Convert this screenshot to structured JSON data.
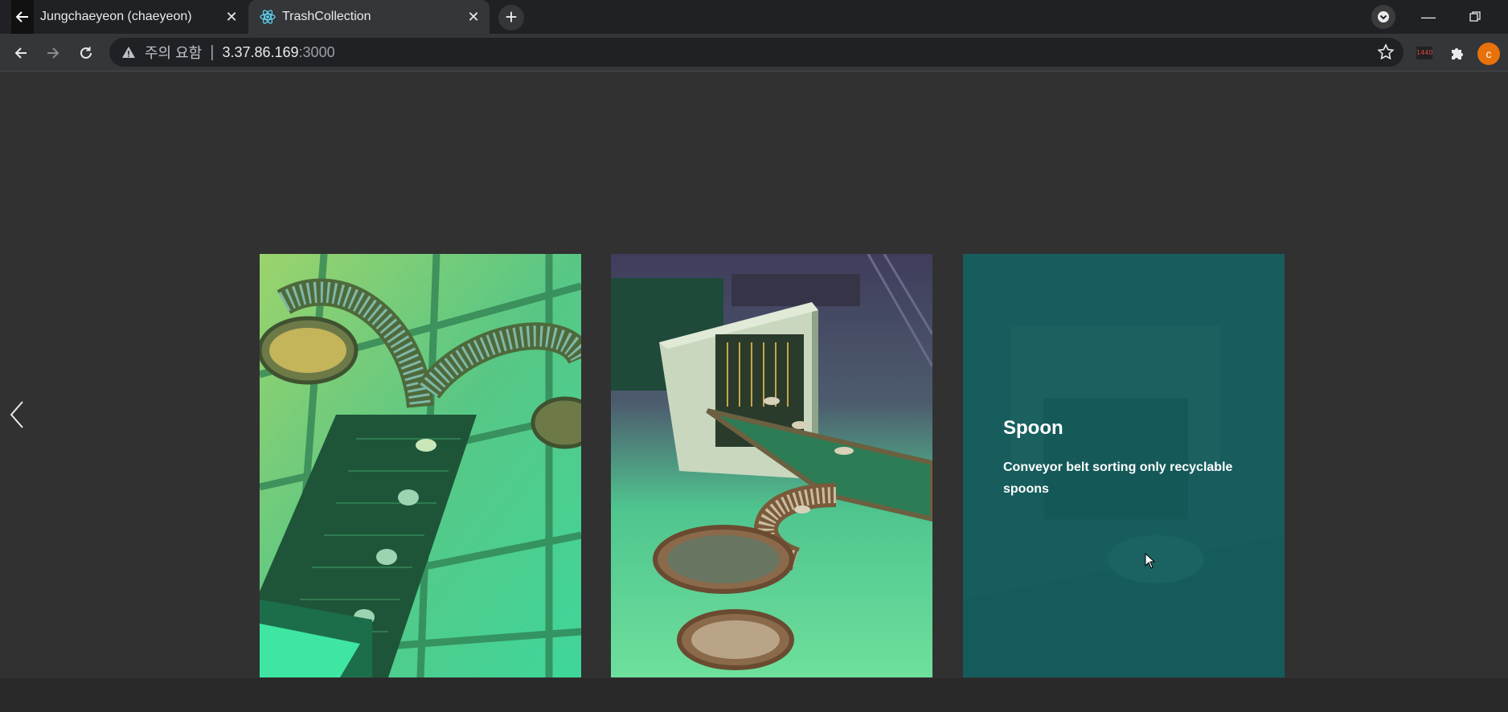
{
  "browser": {
    "tabs": [
      {
        "label": "Jungchaeyeon (chaeyeon)",
        "active": false
      },
      {
        "label": "TrashCollection",
        "active": true
      }
    ],
    "omnibox": {
      "security_label": "주의 요함",
      "separator": "|",
      "host": "3.37.86.169",
      "port": ":3000"
    },
    "extension_badge": "1440",
    "avatar_letter": "c",
    "accent_color": "#e8710a"
  },
  "carousel": {
    "cards": [
      {
        "type": "image",
        "alt_icon": "conveyor-scene-image"
      },
      {
        "type": "image",
        "alt_icon": "scanner-scene-image"
      },
      {
        "type": "text",
        "title": "Spoon",
        "description": "Conveyor belt sorting only recyclable spoons"
      }
    ]
  }
}
